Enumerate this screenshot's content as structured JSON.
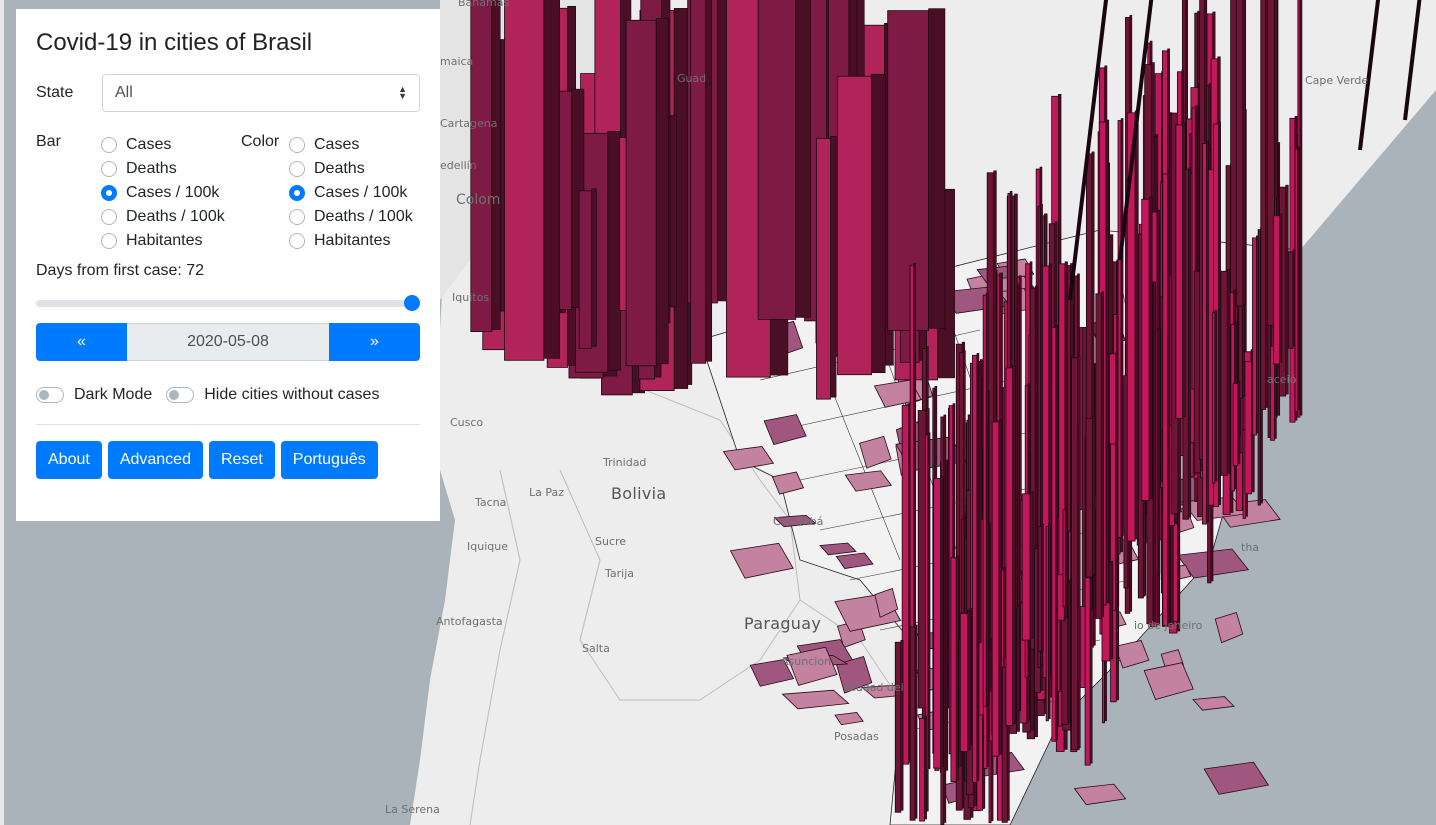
{
  "app": {
    "title": "Covid-19 in cities of Brasil"
  },
  "state": {
    "label": "State",
    "value": "All"
  },
  "bar": {
    "label": "Bar",
    "options": [
      "Cases",
      "Deaths",
      "Cases / 100k",
      "Deaths / 100k",
      "Habitantes"
    ],
    "selected": "Cases / 100k"
  },
  "color": {
    "label": "Color",
    "options": [
      "Cases",
      "Deaths",
      "Cases / 100k",
      "Deaths / 100k",
      "Habitantes"
    ],
    "selected": "Cases / 100k"
  },
  "timeline": {
    "label": "Days from first case: 72",
    "days": 72,
    "slider_position": 1.0,
    "date": "2020-05-08",
    "prev_label": "«",
    "next_label": "»"
  },
  "toggles": {
    "dark_mode": {
      "label": "Dark Mode",
      "on": false
    },
    "hide_cities": {
      "label": "Hide cities without cases",
      "on": false
    }
  },
  "buttons": {
    "about": "About",
    "advanced": "Advanced",
    "reset": "Reset",
    "language": "Português"
  },
  "colors": {
    "accent": "#007bff",
    "bar": "#c2185b",
    "bar_dark": "#4a0f24",
    "land": "#ededed",
    "water": "#aab3ba"
  },
  "map_labels": {
    "bolivia": "Bolivia",
    "paraguay": "Paraguay",
    "trinidad": "Trinidad",
    "la_paz": "La Paz",
    "sucre": "Sucre",
    "tarija": "Tarija",
    "tacna": "Tacna",
    "iquique": "Iquique",
    "antofagasta": "Antofagasta",
    "salta": "Salta",
    "asuncion": "Asuncion",
    "ciudad": "Ciudad del",
    "posadas": "Posadas",
    "la_serena": "La Serena",
    "cusco": "Cusco",
    "iquitos": "Iquitos",
    "colom": "Colom",
    "medellin": "edellín",
    "cartagena": "Cartagena",
    "guad": "Guad",
    "cape_verde": "Cape Verde",
    "corumba": "Corumbá",
    "rio": "io de Janeiro",
    "maceio": "aceió",
    "natha": "tha",
    "jamaica": "maica",
    "bahamas": "Bahamas"
  }
}
